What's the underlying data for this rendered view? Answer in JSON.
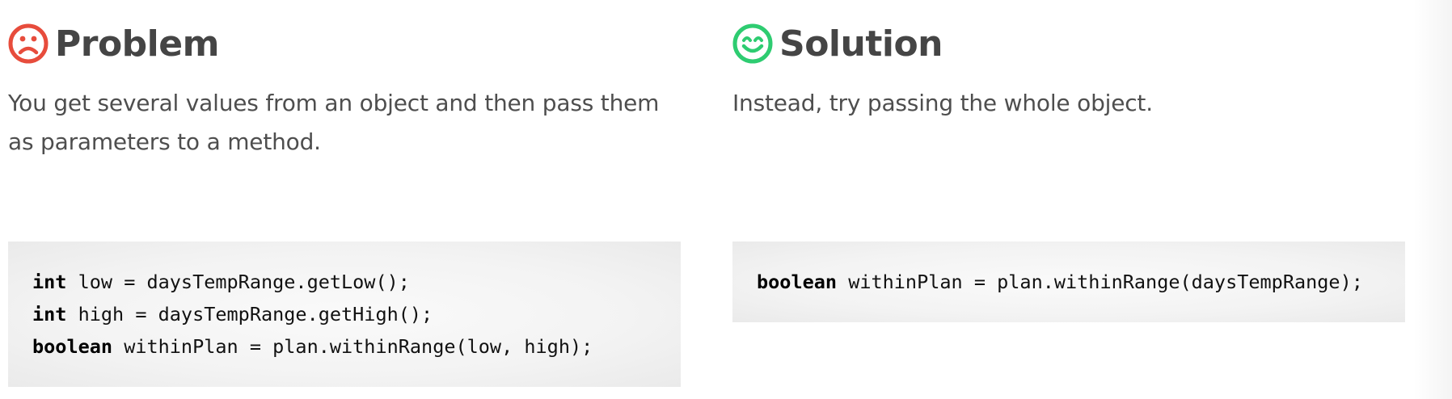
{
  "problem": {
    "title": "Problem",
    "icon": "sad-face-icon",
    "icon_color": "#e74c3c",
    "description": "You get several values from an object and then pass them as parameters to a method.",
    "code_lines": [
      {
        "keyword": "int",
        "rest": " low = daysTempRange.getLow();"
      },
      {
        "keyword": "int",
        "rest": " high = daysTempRange.getHigh();"
      },
      {
        "keyword": "boolean",
        "rest": " withinPlan = plan.withinRange(low, high);"
      }
    ]
  },
  "solution": {
    "title": "Solution",
    "icon": "happy-face-icon",
    "icon_color": "#2ecc71",
    "description": "Instead, try passing the whole object.",
    "code_lines": [
      {
        "keyword": "boolean",
        "rest": " withinPlan = plan.withinRange(daysTempRange);"
      }
    ]
  }
}
